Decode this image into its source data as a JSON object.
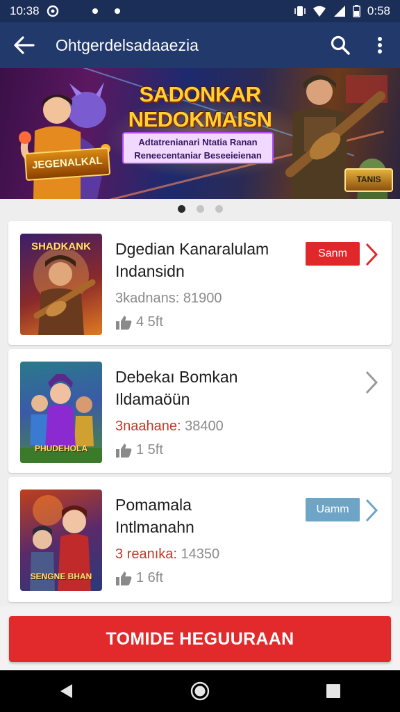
{
  "status_bar": {
    "time": "10:38",
    "battery": "0:58",
    "left_icons": [
      "app-notification-icon",
      "dot",
      "dot"
    ],
    "right_icons": [
      "vibrate-icon",
      "wifi-icon",
      "signal-icon",
      "battery-icon"
    ]
  },
  "app_bar": {
    "title": "Ohtgerdelsadaaezia",
    "back_icon": "arrow-left-icon",
    "actions": [
      "search-icon",
      "more-vert-icon"
    ],
    "color": "#22396b"
  },
  "banner": {
    "heading_line1": "SADONKAR",
    "heading_line2": "NEDOKMAISN",
    "sub_line1": "Adtatrenianari Ntatia Ranan",
    "sub_line2": "Reneecentaniar Beseeieienan",
    "logo_left": "JEGENALKAL",
    "logo_right": "TANIS"
  },
  "carousel": {
    "page_count": 3,
    "active_index": 0
  },
  "games": [
    {
      "title_line1": "Dgedian Kanaralulam",
      "title_line2": "Indansidn",
      "meta_label": "3kadnans:",
      "meta_value": "81900",
      "meta_red": false,
      "likes": "4 5ft",
      "thumb_label": "SHADKANK",
      "badge": "Sanm",
      "badge_style": "red"
    },
    {
      "title_line1": "Debekaı Bomkan",
      "title_line2": "Ildamaöün",
      "meta_label": "3naahane:",
      "meta_value": "38400",
      "meta_red": true,
      "likes": "1 5ft",
      "thumb_label": "PHUDEHOLA",
      "badge": null,
      "badge_style": null
    },
    {
      "title_line1": "Pomamala",
      "title_line2": "Intlmanahn",
      "meta_label": "3 reanıka:",
      "meta_value": "14350",
      "meta_red": true,
      "likes": "1 6ft",
      "thumb_label": "SENGNE BHAN",
      "badge": "Uamm",
      "badge_style": "blue"
    }
  ],
  "cta": {
    "label": "TOMIDE HEGUURAAN",
    "color": "#e22a2c"
  },
  "nav_bar": {
    "buttons": [
      "back-triangle-icon",
      "home-circle-icon",
      "recents-square-icon"
    ]
  }
}
